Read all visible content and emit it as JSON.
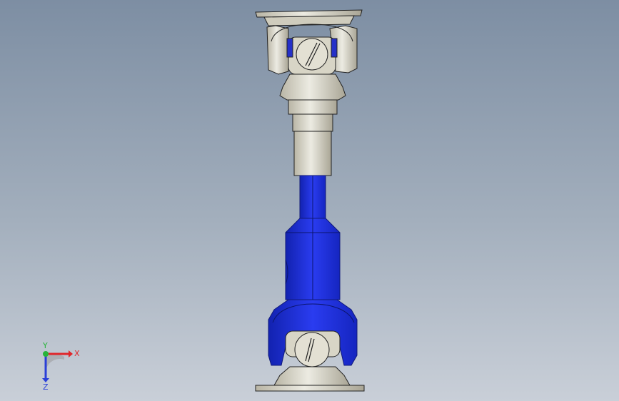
{
  "viewport": {
    "background_top": "#7d8ea3",
    "background_bottom": "#c9cfd8"
  },
  "model": {
    "part_colors": {
      "steel": "#d9d6c8",
      "steel_shade": "#b7b3a3",
      "blue": "#1f2fd6",
      "blue_dark": "#12209c"
    }
  },
  "triad": {
    "x_label": "X",
    "y_label": "Y",
    "z_label": "Z",
    "x_color": "#e0262a",
    "y_color": "#27b43a",
    "z_color": "#2a3fd8"
  }
}
